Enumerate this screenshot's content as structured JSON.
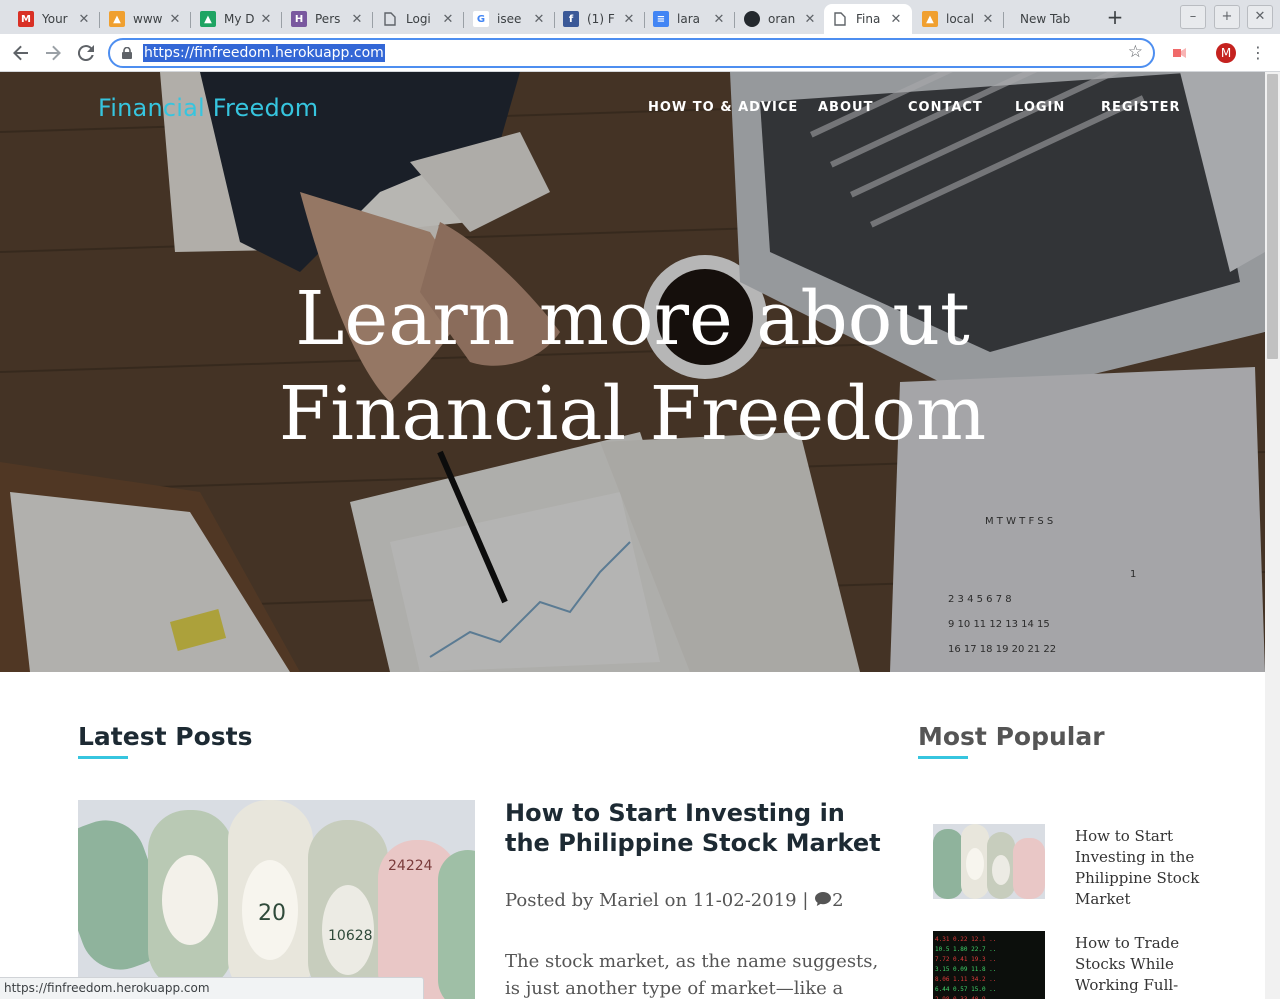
{
  "browser": {
    "tabs": [
      {
        "title": "Your",
        "icon": "gmail-icon",
        "color": "#d93025",
        "glyph": "M"
      },
      {
        "title": "www",
        "icon": "phpmyadmin-icon",
        "color": "#f0a030",
        "glyph": "▲"
      },
      {
        "title": "My D",
        "icon": "google-drive-icon",
        "color": "#1fa463",
        "glyph": "▲"
      },
      {
        "title": "Pers",
        "icon": "heroku-icon",
        "color": "#79589f",
        "glyph": "H"
      },
      {
        "title": "Logi",
        "icon": "page-icon",
        "color": "#ffffff",
        "glyph": ""
      },
      {
        "title": "isee",
        "icon": "google-icon",
        "color": "#ffffff",
        "glyph": "G"
      },
      {
        "title": "(1) F",
        "icon": "facebook-icon",
        "color": "#3b5998",
        "glyph": "f"
      },
      {
        "title": "lara",
        "icon": "google-docs-icon",
        "color": "#4285f4",
        "glyph": "≡"
      },
      {
        "title": "oran",
        "icon": "github-icon",
        "color": "#24292e",
        "glyph": "●"
      },
      {
        "title": "Fina",
        "icon": "page-icon",
        "color": "#ffffff",
        "glyph": "",
        "active": true
      },
      {
        "title": "local",
        "icon": "phpmyadmin-icon",
        "color": "#f0a030",
        "glyph": "▲"
      },
      {
        "title": "New Tab",
        "icon": "",
        "color": "",
        "glyph": ""
      }
    ],
    "url": "https://finfreedom.herokuapp.com",
    "avatar_letter": "M",
    "status_url": "https://finfreedom.herokuapp.com"
  },
  "site": {
    "brand": "Financial Freedom",
    "nav": [
      "HOW TO & ADVICE",
      "ABOUT",
      "CONTACT",
      "LOGIN",
      "REGISTER"
    ],
    "hero_line1": "Learn more about",
    "hero_line2": "Financial Freedom"
  },
  "latest": {
    "heading": "Latest Posts",
    "post": {
      "title": "How to Start Investing in the Philippine Stock Market",
      "meta_prefix": "Posted by ",
      "author": "Mariel",
      "date_prefix": " on ",
      "date": "11-02-2019",
      "sep": " | ",
      "comments": "2",
      "excerpt": "The stock market, as the name suggests, is just another type of market—like a food"
    }
  },
  "popular": {
    "heading": "Most Popular",
    "items": [
      {
        "title": "How to Start Investing in the Philippine Stock Market"
      },
      {
        "title": "How to Trade Stocks While Working Full-"
      }
    ]
  }
}
